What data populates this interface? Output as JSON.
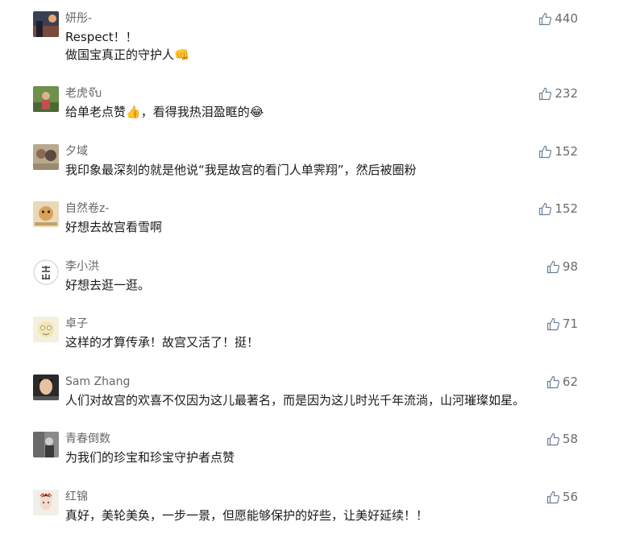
{
  "comments": [
    {
      "user": "妍彤-",
      "lines": [
        "Respect！！",
        "做国宝真正的守护人"
      ],
      "emoji": "👊",
      "likes": "440"
    },
    {
      "user": "老虎จ๊บ",
      "lines": [
        "给单老点赞",
        "，看得我热泪盈眶的"
      ],
      "emoji": "👍",
      "emoji2": "😂",
      "likes": "232"
    },
    {
      "user": "夕域",
      "lines": [
        "我印象最深刻的就是他说“我是故宫的看门人单霁翔”，然后被圈粉"
      ],
      "likes": "152"
    },
    {
      "user": "自然卷z-",
      "lines": [
        "好想去故宫看雪啊"
      ],
      "likes": "152"
    },
    {
      "user": "李小洪",
      "lines": [
        "好想去逛一逛。"
      ],
      "likes": "98"
    },
    {
      "user": "卓子",
      "lines": [
        "这样的才算传承！故宫又活了！挺！"
      ],
      "likes": "71"
    },
    {
      "user": "Sam Zhang",
      "lines": [
        "人们对故宫的欢喜不仅因为这儿最著名，而是因为这儿时光千年流淌，山河璀璨如星。"
      ],
      "likes": "62"
    },
    {
      "user": "青春倒数",
      "lines": [
        "为我们的珍宝和珍宝守护者点赞"
      ],
      "likes": "58"
    },
    {
      "user": "红锦",
      "lines": [
        "真好，美轮美奂，一步一景，但愿能够保护的好些，让美好延续！！"
      ],
      "likes": "56"
    }
  ]
}
